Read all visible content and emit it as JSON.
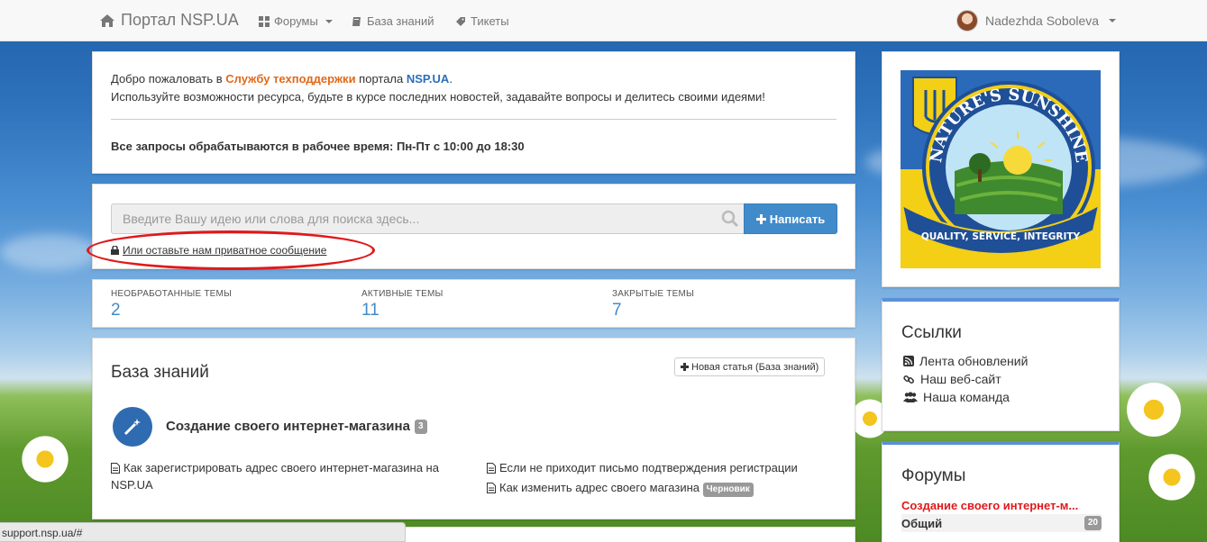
{
  "navbar": {
    "brand": "Портал NSP.UA",
    "forums": "Форумы",
    "knowledge_base": "База знаний",
    "tickets": "Тикеты",
    "user_name": "Nadezhda Soboleva"
  },
  "welcome": {
    "line1_prefix": "Добро пожаловать в ",
    "line1_service": "Службу техподдержки",
    "line1_mid": " портала ",
    "line1_site": "NSP.UA",
    "line1_end": ".",
    "line2": "Используйте возможности ресурса, будьте в курсе последних новостей, задавайте вопросы и делитесь своими идеями!",
    "hours": "Все запросы обрабатываются в рабочее время: Пн-Пт с 10:00 до 18:30"
  },
  "search": {
    "placeholder": "Введите Вашу идею или слова для поиска здесь...",
    "button": "Написать",
    "private_link": "Или оставьте нам приватное сообщение"
  },
  "stats": [
    {
      "label": "НЕОБРАБОТАННЫЕ ТЕМЫ",
      "value": "2"
    },
    {
      "label": "АКТИВНЫЕ ТЕМЫ",
      "value": "11"
    },
    {
      "label": "ЗАКРЫТЫЕ ТЕМЫ",
      "value": "7"
    }
  ],
  "kb": {
    "title": "База знаний",
    "new_article": "Новая статья (База знаний)",
    "category_title": "Создание своего интернет-магазина",
    "category_count": "3",
    "articles": [
      {
        "title": "Как зарегистрировать адрес своего интернет-магазина на NSP.UA"
      },
      {
        "title": "Если не приходит письмо подтверждения регистрации"
      },
      {
        "title": "Как изменить адрес своего магазина",
        "badge": "Черновик"
      }
    ]
  },
  "logo": {
    "brand_text": "NATURE'S SUNSHINE",
    "ribbon_text": "QUALITY, SERVICE, INTEGRITY"
  },
  "links": {
    "title": "Ссылки",
    "items": [
      "Лента обновлений",
      "Наш веб-сайт",
      "Наша команда"
    ]
  },
  "forums": {
    "title": "Форумы",
    "highlight": "Создание своего интернет-м...",
    "row_name": "Общий",
    "row_count": "20"
  },
  "statusbar": {
    "url": "support.nsp.ua/#"
  },
  "colors": {
    "accent": "#428bca",
    "orange": "#e06a1b",
    "red": "#e0191b"
  }
}
